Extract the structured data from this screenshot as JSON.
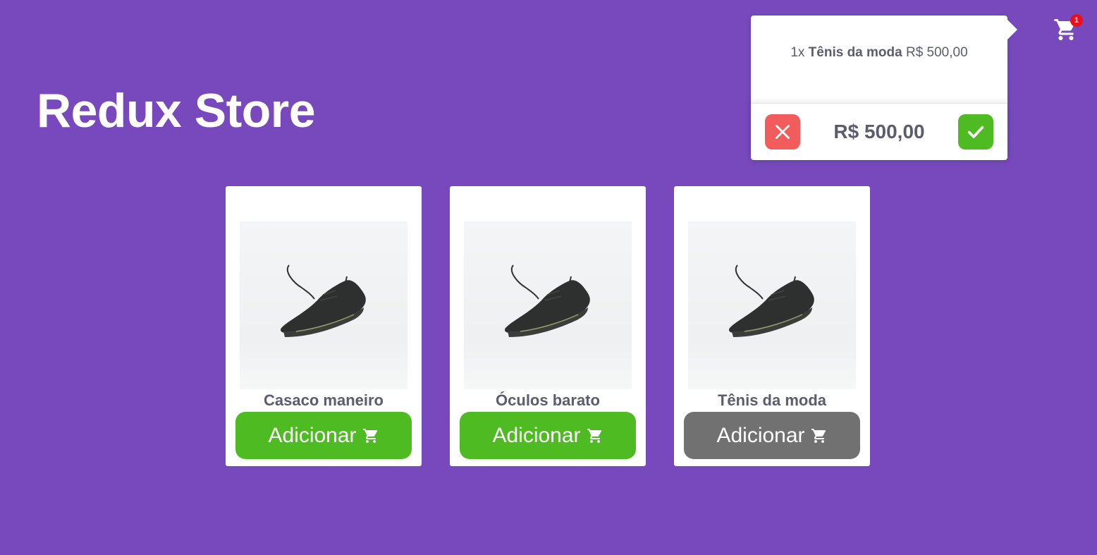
{
  "header": {
    "title": "Redux Store"
  },
  "cart": {
    "badge_count": "1",
    "items": [
      {
        "qty": "1x",
        "name": "Tênis da moda",
        "price": "R$ 500,00"
      }
    ],
    "total": "R$ 500,00",
    "icons": {
      "clear": "close-icon",
      "confirm": "check-icon",
      "cart": "cart-icon"
    }
  },
  "products": [
    {
      "name": "Casaco maneiro",
      "button_label": "Adicionar",
      "button_state": "enabled"
    },
    {
      "name": "Óculos barato",
      "button_label": "Adicionar",
      "button_state": "enabled"
    },
    {
      "name": "Tênis da moda",
      "button_label": "Adicionar",
      "button_state": "disabled"
    }
  ],
  "colors": {
    "background": "#7749bd",
    "primary_green": "#4fbb22",
    "disabled_gray": "#717171",
    "danger_red": "#f25c5c",
    "text": "#5c5c6e"
  }
}
